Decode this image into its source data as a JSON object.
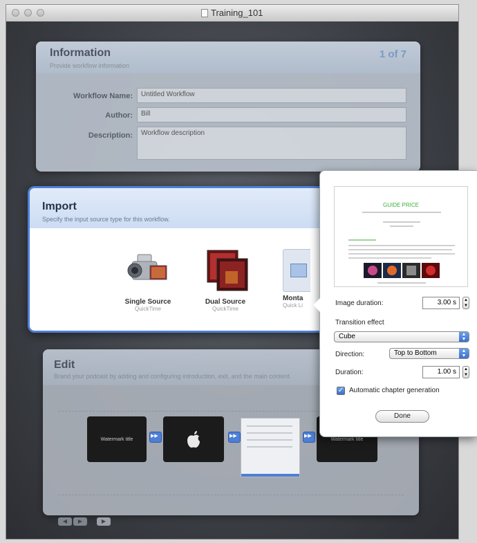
{
  "window": {
    "title": "Training_101"
  },
  "information": {
    "title": "Information",
    "subtitle": "Provide workflow information",
    "step": "1 of 7",
    "workflow_name_label": "Workflow Name:",
    "workflow_name_value": "Untitled Workflow",
    "author_label": "Author:",
    "author_value": "Bill",
    "description_label": "Description:",
    "description_value": "Workflow description"
  },
  "import": {
    "title": "Import",
    "subtitle": "Specify the input source type for this workflow.",
    "sources": [
      {
        "name": "Single Source",
        "sub": "QuickTime"
      },
      {
        "name": "Dual Source",
        "sub": "QuickTime"
      },
      {
        "name": "Monta",
        "sub": "Quick Li"
      }
    ]
  },
  "edit": {
    "title": "Edit",
    "subtitle": "Brand your podcast by adding and configuring introduction, exit, and the main content.",
    "clips": [
      "Watermark title",
      "",
      "",
      "Watermark title"
    ]
  },
  "popover": {
    "thumb_title": "GUIDE PRICE",
    "image_duration_label": "Image duration:",
    "image_duration_value": "3.00 s",
    "transition_label": "Transition effect",
    "transition_value": "Cube",
    "direction_label": "Direction:",
    "direction_value": "Top to Bottom",
    "duration_label": "Duration:",
    "duration_value": "1.00 s",
    "auto_chapter_label": "Automatic chapter generation",
    "auto_chapter_checked": true,
    "done_label": "Done"
  }
}
